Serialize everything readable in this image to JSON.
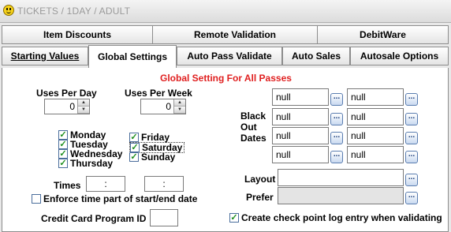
{
  "window": {
    "title": "TICKETS / 1DAY / ADULT"
  },
  "tabs_row1": [
    {
      "label": "Item Discounts"
    },
    {
      "label": "Remote Validation"
    },
    {
      "label": "DebitWare"
    }
  ],
  "tabs_row2": [
    {
      "label": "Starting Values"
    },
    {
      "label": "Global Settings",
      "active": true
    },
    {
      "label": "Auto Pass Validate"
    },
    {
      "label": "Auto Sales"
    },
    {
      "label": "Autosale Options"
    }
  ],
  "panel": {
    "heading": "Global Setting For All Passes",
    "uses_per_day": {
      "label": "Uses Per Day",
      "value": "0"
    },
    "uses_per_week": {
      "label": "Uses Per Week",
      "value": "0"
    },
    "days": [
      {
        "label": "Monday",
        "checked": true
      },
      {
        "label": "Tuesday",
        "checked": true
      },
      {
        "label": "Wednesday",
        "checked": true
      },
      {
        "label": "Thursday",
        "checked": true
      },
      {
        "label": "Friday",
        "checked": true
      },
      {
        "label": "Saturday",
        "checked": true
      },
      {
        "label": "Sunday",
        "checked": true
      }
    ],
    "times": {
      "label": "Times",
      "start": ":",
      "end": ":"
    },
    "enforce_time": {
      "label": "Enforce time part of start/end date",
      "checked": false
    },
    "credit_card": {
      "label": "Credit Card Program ID",
      "value": ""
    },
    "black_out": {
      "label_line1": "Black",
      "label_line2": "Out",
      "label_line3": "Dates",
      "dates": [
        "null",
        "null",
        "null",
        "null",
        "null",
        "null",
        "null",
        "null"
      ],
      "button_glyph": "..."
    },
    "layout": {
      "label": "Layout",
      "value": ""
    },
    "prefer": {
      "label": "Prefer",
      "value": ""
    },
    "checkpoint_log": {
      "label": "Create check point log entry when validating",
      "checked": true
    }
  },
  "colors": {
    "heading": "#e02020",
    "check": "#1f8f1f"
  }
}
